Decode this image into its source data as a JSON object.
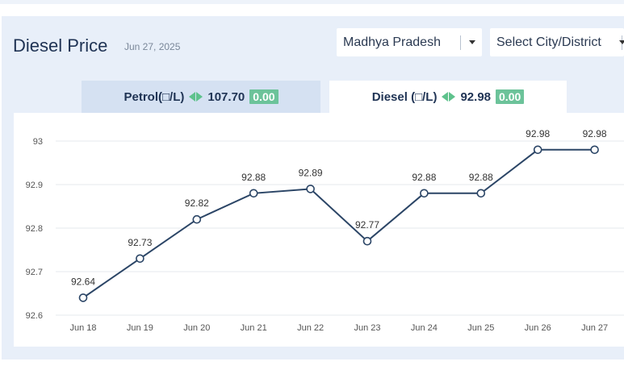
{
  "header": {
    "title": "Diesel Price",
    "date": "Jun 27, 2025"
  },
  "filters": {
    "state_value": "Madhya Pradesh",
    "city_placeholder": "Select City/District"
  },
  "tabs": {
    "petrol": {
      "label": "Petrol(□/L)",
      "price": "107.70",
      "change": "0.00"
    },
    "diesel": {
      "label": "Diesel (□/L)",
      "price": "92.98",
      "change": "0.00"
    }
  },
  "colors": {
    "line": "#2b4566",
    "accent": "#6cc39a",
    "grid": "#e6e9ee"
  },
  "chart_data": {
    "type": "line",
    "categories": [
      "Jun 18",
      "Jun 19",
      "Jun 20",
      "Jun 21",
      "Jun 22",
      "Jun 23",
      "Jun 24",
      "Jun 25",
      "Jun 26",
      "Jun 27"
    ],
    "values": [
      92.64,
      92.73,
      92.82,
      92.88,
      92.89,
      92.77,
      92.88,
      92.88,
      92.98,
      92.98
    ],
    "data_labels": [
      "92.64",
      "92.73",
      "92.82",
      "92.88",
      "92.89",
      "92.77",
      "92.88",
      "92.88",
      "92.98",
      "92.98"
    ],
    "yticks": [
      "92.6",
      "92.7",
      "92.8",
      "92.9",
      "93"
    ],
    "ylim": [
      92.6,
      93
    ],
    "grid": true,
    "title": "",
    "xlabel": "",
    "ylabel": ""
  }
}
